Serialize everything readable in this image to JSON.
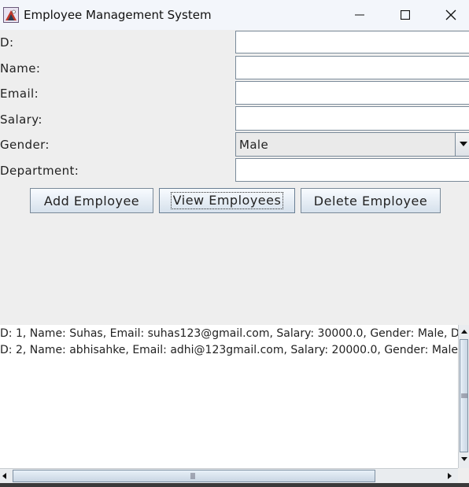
{
  "window": {
    "title": "Employee Management System"
  },
  "form": {
    "id_label": "D:",
    "name_label": "Name:",
    "email_label": "Email:",
    "salary_label": "Salary:",
    "gender_label": "Gender:",
    "department_label": "Department:",
    "id_value": "",
    "name_value": "",
    "email_value": "",
    "salary_value": "",
    "gender_selected": "Male",
    "department_value": ""
  },
  "buttons": {
    "add": "Add Employee",
    "view": "View Employees",
    "delete": "Delete Employee"
  },
  "output": {
    "lines": [
      "D: 1, Name: Suhas, Email: suhas123@gmail.com, Salary: 30000.0, Gender: Male, Department",
      "D: 2, Name: abhisahke, Email: adhi@123gmail.com, Salary: 20000.0, Gender: Male, Department"
    ]
  },
  "icons": {
    "app": "java-app-icon",
    "minimize": "minimize-icon",
    "maximize": "maximize-icon",
    "close": "close-icon"
  }
}
